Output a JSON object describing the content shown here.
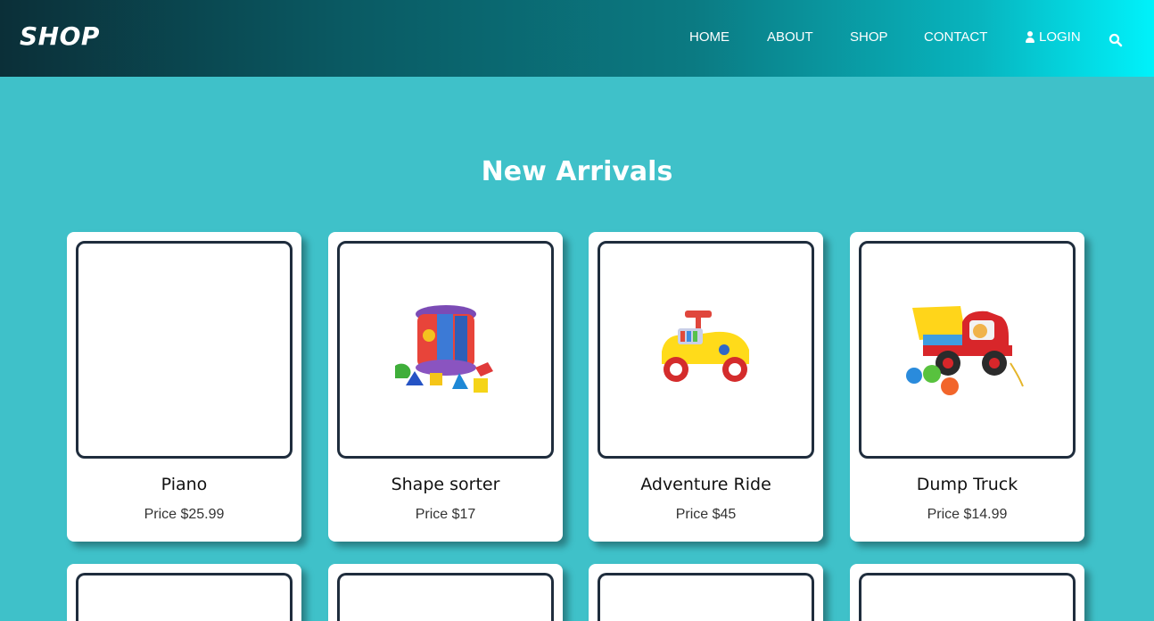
{
  "header": {
    "brand": "SHOP",
    "nav": [
      {
        "label": "HOME"
      },
      {
        "label": "ABOUT"
      },
      {
        "label": "SHOP"
      },
      {
        "label": "CONTACT"
      },
      {
        "label": "LOGIN"
      }
    ],
    "icons": {
      "login": "user-icon",
      "search": "search-icon"
    }
  },
  "main": {
    "section_title": "New Arrivals",
    "products": [
      {
        "name": "Piano",
        "price": "Price $25.99",
        "image": "blank"
      },
      {
        "name": "Shape sorter",
        "price": "Price $17",
        "image": "shape-sorter-toy"
      },
      {
        "name": "Adventure Ride",
        "price": "Price $45",
        "image": "ride-on-car-toy"
      },
      {
        "name": "Dump Truck",
        "price": "Price $14.99",
        "image": "dump-truck-toy"
      }
    ]
  },
  "colors": {
    "background": "#3fc1c9",
    "card": "#ffffff",
    "image_border": "#1f2d3d",
    "header_gradient_start": "#0b2f38",
    "header_gradient_end": "#00f2fb"
  }
}
